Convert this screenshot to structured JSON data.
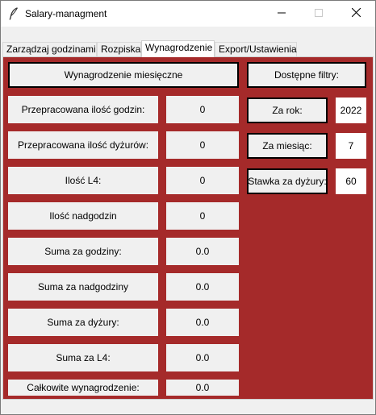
{
  "window": {
    "title": "Salary-managment",
    "icon": "feather-icon",
    "controls": [
      "minimize-icon",
      "maximize-icon",
      "close-icon"
    ]
  },
  "tabs": [
    {
      "label": "Zarządzaj godzinami",
      "active": false
    },
    {
      "label": "Rozpiska",
      "active": false
    },
    {
      "label": "Wynagrodzenie",
      "active": true
    },
    {
      "label": "Export/Ustawienia",
      "active": false
    }
  ],
  "salary": {
    "header": "Wynagrodzenie miesięczne",
    "rows": [
      {
        "label": "Przepracowana ilość godzin:",
        "value": "0"
      },
      {
        "label": "Przepracowana ilość dyżurów:",
        "value": "0"
      },
      {
        "label": "Ilość L4:",
        "value": "0"
      },
      {
        "label": "Ilość nadgodzin",
        "value": "0"
      },
      {
        "label": "Suma za godziny:",
        "value": "0.0"
      },
      {
        "label": "Suma za nadgodziny",
        "value": "0.0"
      },
      {
        "label": "Suma za dyżury:",
        "value": "0.0"
      },
      {
        "label": "Suma za L4:",
        "value": "0.0"
      },
      {
        "label": "Całkowite wynagrodzenie:",
        "value": "0.0"
      }
    ]
  },
  "filters": {
    "header": "Dostępne filtry:",
    "items": [
      {
        "label": "Za rok:",
        "value": "2022"
      },
      {
        "label": "Za miesiąc:",
        "value": "7"
      },
      {
        "label": "Stawka za dyżury:",
        "value": "60"
      }
    ]
  },
  "colors": {
    "panel_background": "#a52a2a",
    "widget_background": "#f0f0f0"
  }
}
